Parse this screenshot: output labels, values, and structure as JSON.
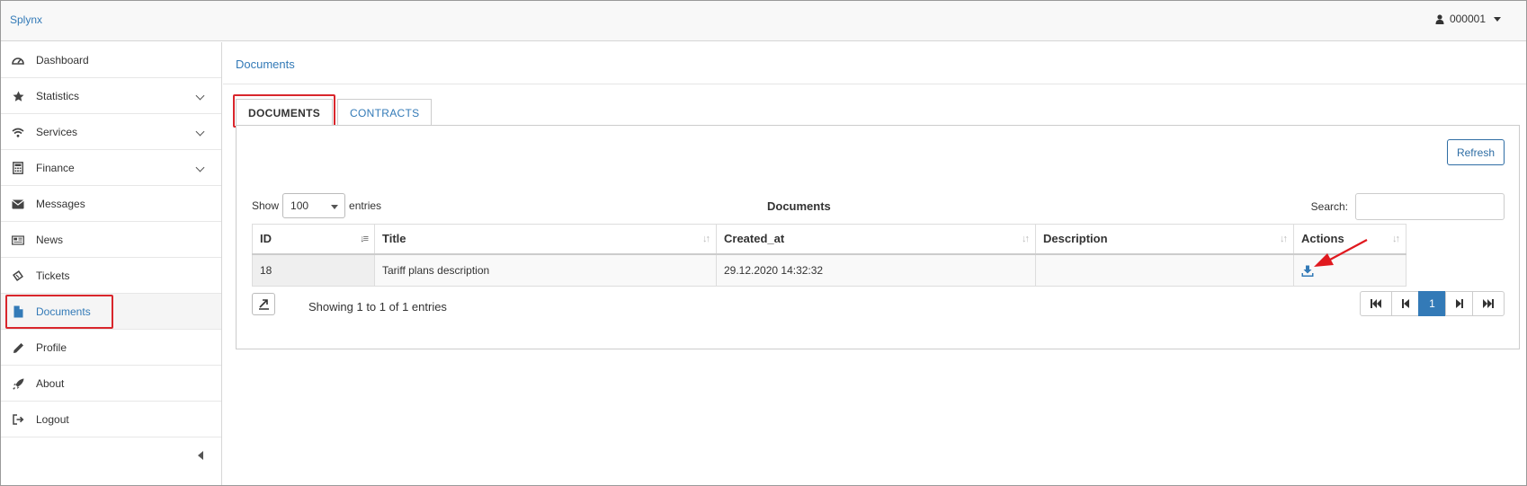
{
  "header": {
    "brand": "Splynx",
    "user": "000001"
  },
  "sidebar": {
    "items": [
      {
        "label": "Dashboard",
        "icon": "dashboard-icon",
        "expandable": false
      },
      {
        "label": "Statistics",
        "icon": "star-icon",
        "expandable": true
      },
      {
        "label": "Services",
        "icon": "wifi-icon",
        "expandable": true
      },
      {
        "label": "Finance",
        "icon": "calculator-icon",
        "expandable": true
      },
      {
        "label": "Messages",
        "icon": "envelope-icon",
        "expandable": false
      },
      {
        "label": "News",
        "icon": "newspaper-icon",
        "expandable": false
      },
      {
        "label": "Tickets",
        "icon": "ticket-icon",
        "expandable": false
      },
      {
        "label": "Documents",
        "icon": "file-icon",
        "expandable": false,
        "active": true
      },
      {
        "label": "Profile",
        "icon": "pencil-icon",
        "expandable": false
      },
      {
        "label": "About",
        "icon": "rocket-icon",
        "expandable": false
      },
      {
        "label": "Logout",
        "icon": "logout-icon",
        "expandable": false
      }
    ]
  },
  "breadcrumb": "Documents",
  "tabs": [
    {
      "label": "DOCUMENTS",
      "active": true
    },
    {
      "label": "CONTRACTS",
      "active": false
    }
  ],
  "toolbar": {
    "refresh_label": "Refresh"
  },
  "table_controls": {
    "show_label": "Show",
    "page_size": "100",
    "entries_label": "entries",
    "title": "Documents",
    "search_label": "Search:"
  },
  "table": {
    "columns": [
      "ID",
      "Title",
      "Created_at",
      "Description",
      "Actions"
    ],
    "rows": [
      {
        "id": "18",
        "title": "Tariff plans description",
        "created_at": "29.12.2020 14:32:32",
        "description": ""
      }
    ]
  },
  "footer": {
    "info": "Showing 1 to 1 of 1 entries",
    "current_page": "1"
  },
  "colors": {
    "accent": "#337ab7",
    "highlight": "#d9262c"
  }
}
